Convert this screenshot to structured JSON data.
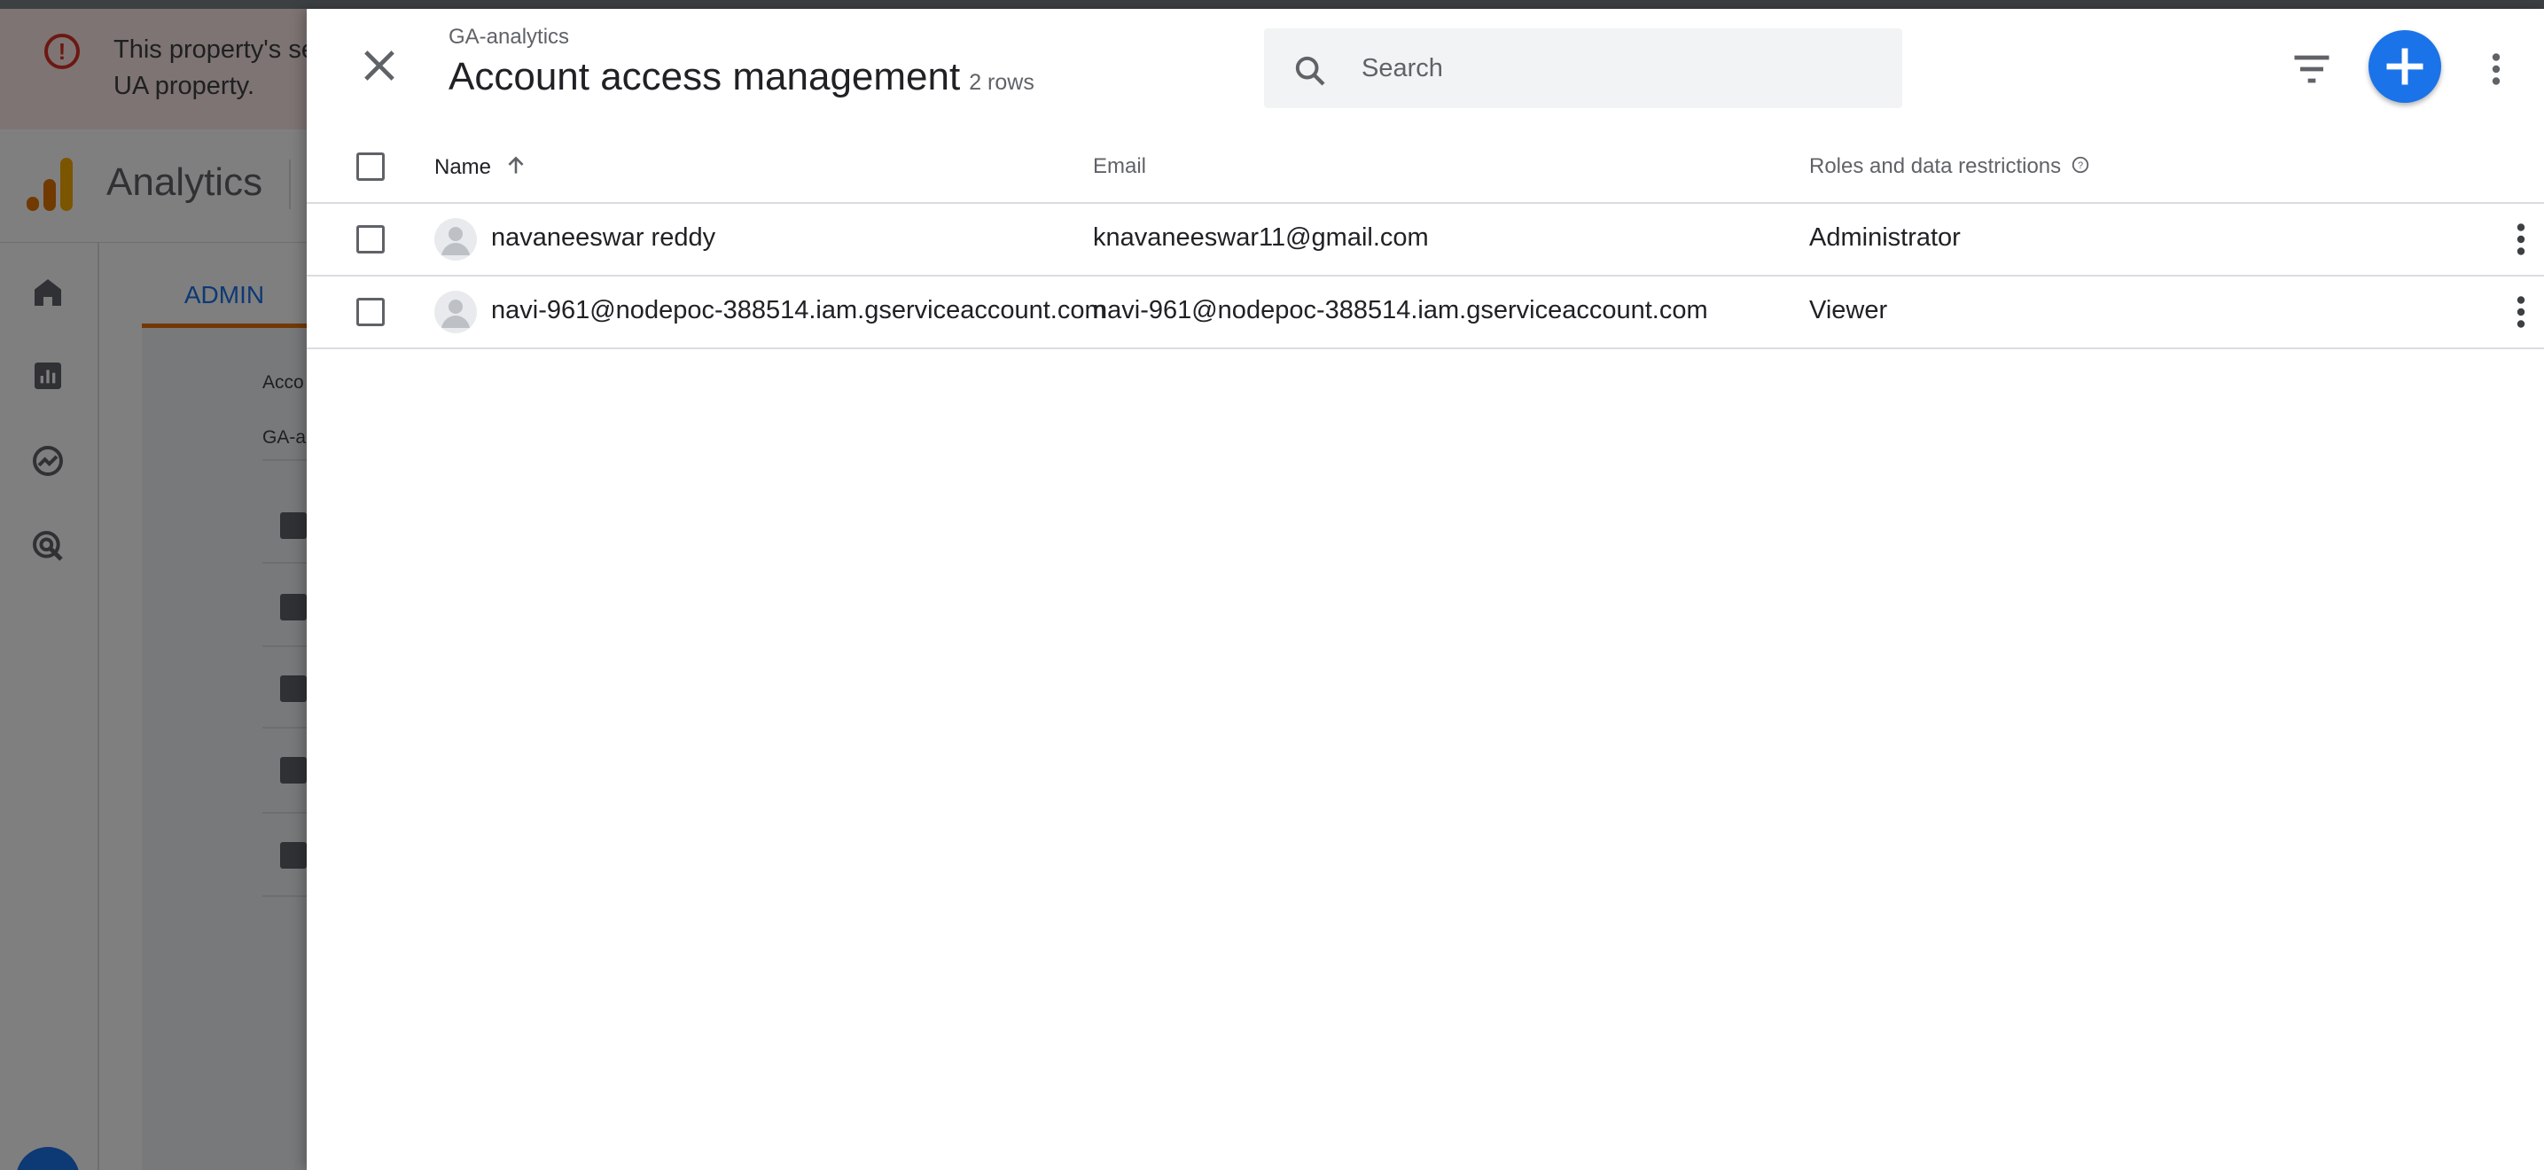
{
  "background": {
    "banner_text": "This property's se UA property.",
    "banner_line1": "This property's se",
    "banner_line2": "UA property.",
    "app_name": "Analytics",
    "admin_tab": "ADMIN",
    "account_label": "Acco",
    "account_value": "GA-an"
  },
  "dialog": {
    "subtitle": "GA-analytics",
    "title": "Account access management",
    "row_count": "2 rows",
    "search": {
      "placeholder": "Search",
      "value": ""
    },
    "icons": {
      "close": "close-icon",
      "search": "search-icon",
      "filter": "filter-icon",
      "add": "add-icon",
      "more": "more-vert-icon",
      "help": "help-icon",
      "sort": "arrow-up-icon",
      "avatar": "person-icon"
    },
    "colors": {
      "accent": "#1a73e8",
      "warning": "#d93025",
      "ga_orange": "#e37400"
    }
  },
  "table": {
    "columns": {
      "name": "Name",
      "email": "Email",
      "roles": "Roles and data restrictions"
    },
    "sort": {
      "column": "Name",
      "direction": "ascending"
    },
    "rows": [
      {
        "name": "navaneeswar reddy",
        "email": "knavaneeswar11@gmail.com",
        "role": "Administrator"
      },
      {
        "name": "navi-961@nodepoc-388514.iam.gserviceaccount.com",
        "email": "navi-961@nodepoc-388514.iam.gserviceaccount.com",
        "role": "Viewer"
      }
    ]
  }
}
